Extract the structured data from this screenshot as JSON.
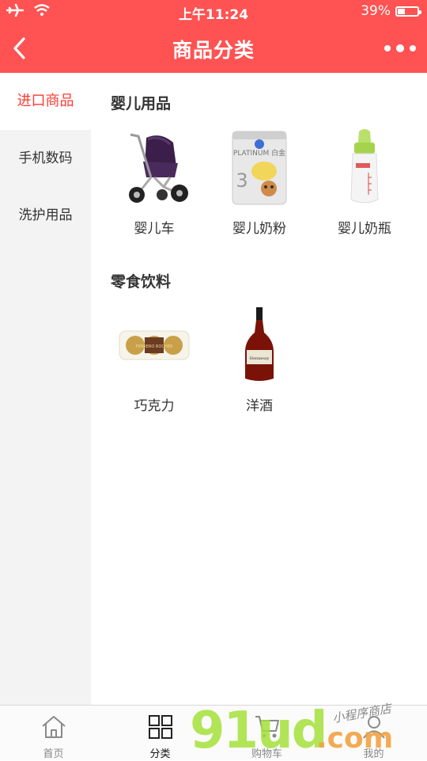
{
  "status_bar": {
    "time": "上午11:24",
    "battery_text": "39%",
    "battery_level": 0.39
  },
  "nav": {
    "title": "商品分类",
    "back_icon": "chevron-left-icon",
    "more_icon": "more-dots-icon"
  },
  "sidebar": {
    "items": [
      {
        "label": "进口商品",
        "active": true
      },
      {
        "label": "手机数码",
        "active": false
      },
      {
        "label": "洗护用品",
        "active": false
      }
    ]
  },
  "sections": [
    {
      "title": "婴儿用品",
      "products": [
        {
          "label": "婴儿车",
          "icon": "stroller-image"
        },
        {
          "label": "婴儿奶粉",
          "icon": "milk-powder-can-image"
        },
        {
          "label": "婴儿奶瓶",
          "icon": "baby-bottle-image"
        }
      ]
    },
    {
      "title": "零食饮料",
      "products": [
        {
          "label": "巧克力",
          "icon": "chocolate-box-image"
        },
        {
          "label": "洋酒",
          "icon": "cognac-bottle-image"
        }
      ]
    }
  ],
  "product_art": {
    "milk_can_brand": "PLATINUM 白金",
    "milk_can_stage": "3",
    "chocolate_brand": "FERRERO ROCHER",
    "liquor_brand": "Hennessy"
  },
  "tabbar": {
    "tabs": [
      {
        "label": "首页",
        "icon": "home-icon",
        "active": false
      },
      {
        "label": "分类",
        "icon": "category-grid-icon",
        "active": true
      },
      {
        "label": "购物车",
        "icon": "cart-icon",
        "active": false
      },
      {
        "label": "我的",
        "icon": "user-icon",
        "active": false
      }
    ]
  },
  "watermark": {
    "main": "91ud",
    "suffix": ".com",
    "tagline": "小程序商店"
  },
  "colors": {
    "brand_red": "#ff5252",
    "active_red": "#ff3b30",
    "sidebar_bg": "#f3f3f3"
  }
}
